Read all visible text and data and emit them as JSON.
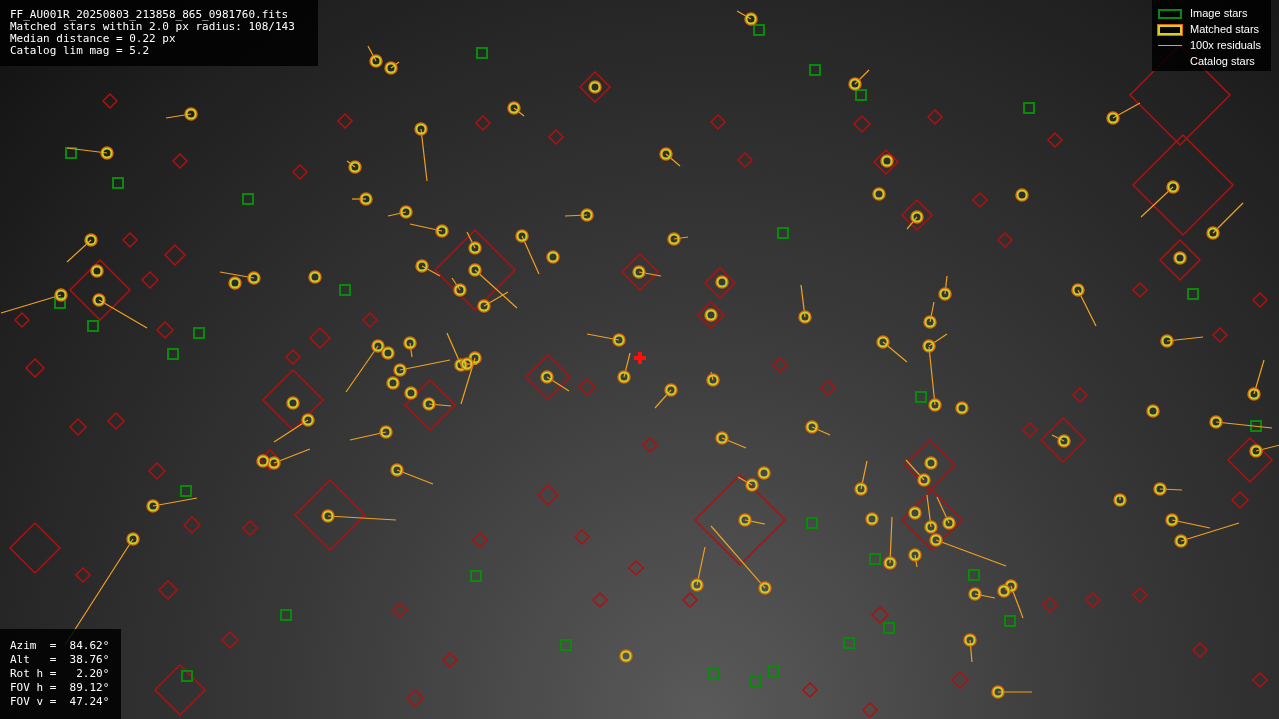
{
  "info_lines": [
    "FF_AU001R_20250803_213858_865_0981760.fits",
    "Matched stars within 2.0 px radius: 108/143",
    "Median distance = 0.22 px",
    "Catalog lim mag = 5.2"
  ],
  "legend": [
    {
      "kind": "image",
      "label": "Image stars"
    },
    {
      "kind": "matched",
      "label": "Matched stars"
    },
    {
      "kind": "residual",
      "label": "100x residuals"
    },
    {
      "kind": "catalog",
      "label": "Catalog stars"
    }
  ],
  "pointing": [
    "Azim  =  84.62°",
    "Alt   =  38.76°",
    "Rot h =   2.20°",
    "FOV h =  89.12°",
    "FOV v =  47.24°"
  ]
}
